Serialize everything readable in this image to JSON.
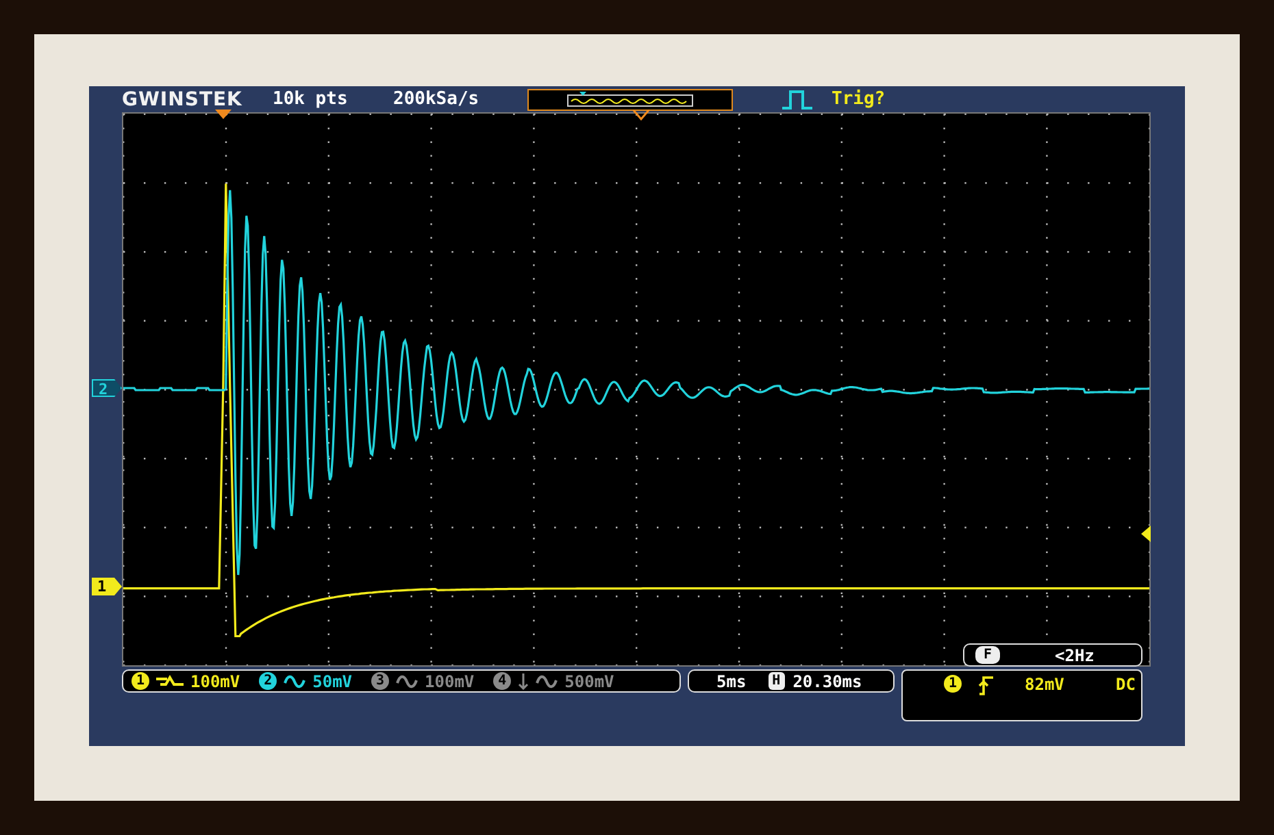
{
  "header": {
    "brand": "GWINSTEK",
    "record_length": "10k pts",
    "sample_rate": "200kSa/s",
    "trigger_status": "Trig?"
  },
  "channels": [
    {
      "number": "1",
      "kind": "step",
      "arrow": false,
      "scale": "100mV",
      "enabled": true,
      "color": "#f2ea1c"
    },
    {
      "number": "2",
      "kind": "wave",
      "arrow": false,
      "scale": "50mV",
      "enabled": true,
      "color": "#22d3dc"
    },
    {
      "number": "3",
      "kind": "wave",
      "arrow": false,
      "scale": "100mV",
      "enabled": false
    },
    {
      "number": "4",
      "kind": "wave",
      "arrow": true,
      "scale": "500mV",
      "enabled": false
    }
  ],
  "markers": [
    {
      "label": "2",
      "kind": "outline",
      "color": "#22d3dc"
    },
    {
      "label": "1",
      "kind": "solid",
      "color": "#f2ea1c"
    }
  ],
  "timebase": {
    "scale": "5ms",
    "position_label": "H",
    "position": "20.30ms"
  },
  "trigger": {
    "frequency_label": "F",
    "frequency": "<2Hz",
    "source": "1",
    "slope": {
      "kind": "rising"
    },
    "level": "82mV",
    "coupling": "DC"
  }
}
